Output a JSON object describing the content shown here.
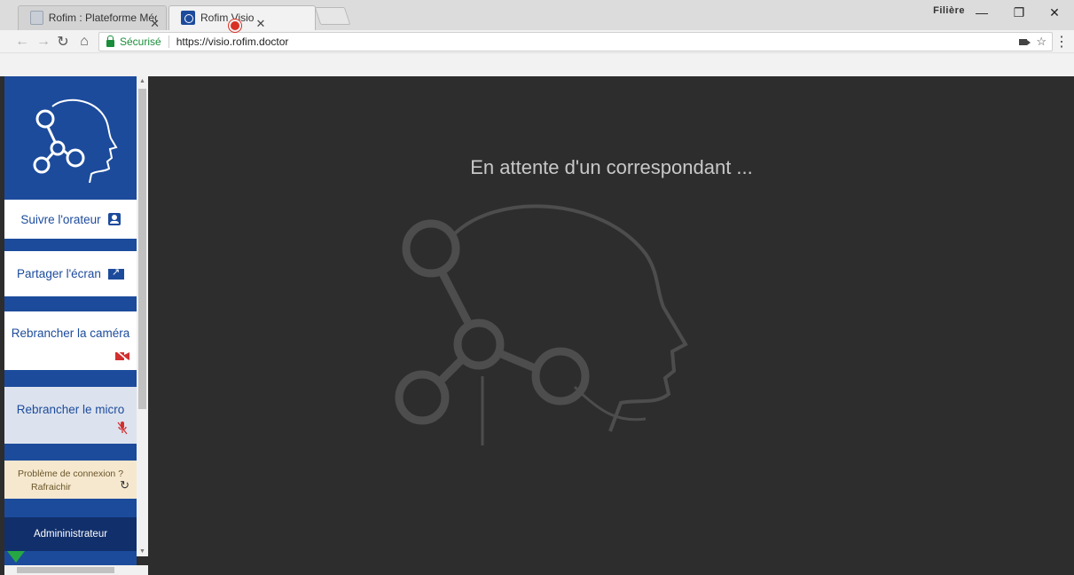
{
  "browser": {
    "tabs": [
      {
        "title": "Rofim : Plateforme Médic",
        "active": false
      },
      {
        "title": "Rofim Visio",
        "active": true,
        "recording": true
      }
    ],
    "window_label": "Filière",
    "omnibox": {
      "secure_label": "Sécurisé",
      "url": "https://visio.rofim.doctor"
    }
  },
  "sidebar": {
    "follow_label": "Suivre l'orateur",
    "share_label": "Partager l'écran",
    "camera_label": "Rebrancher la caméra",
    "micro_label": "Rebrancher le micro",
    "connection_problem": "Problème de connexion ?",
    "refresh_label": "Rafraichir",
    "admin_label": "Admininistrateur"
  },
  "main": {
    "waiting_text": "En attente d'un correspondant ..."
  },
  "colors": {
    "brand_blue": "#1c4b9c",
    "background": "#2d2d2d",
    "alert_red": "#d32f2f",
    "connection_bg": "#f5e8cf"
  }
}
